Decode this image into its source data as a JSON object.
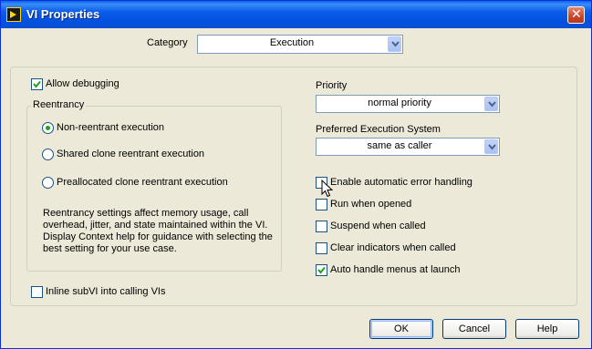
{
  "window": {
    "title": "VI Properties",
    "app_icon": "labview-vi-icon",
    "close_glyph": "✕"
  },
  "category": {
    "label": "Category",
    "value": "Execution"
  },
  "allow_debugging": {
    "label": "Allow debugging",
    "checked": true
  },
  "reentrancy": {
    "legend": "Reentrancy",
    "options": [
      {
        "label": "Non-reentrant execution",
        "selected": true
      },
      {
        "label": "Shared clone reentrant execution",
        "selected": false
      },
      {
        "label": "Preallocated clone reentrant execution",
        "selected": false
      }
    ],
    "note": "Reentrancy settings affect memory usage, call overhead, jitter, and state maintained within the VI. Display Context help for guidance with selecting the best setting for your use case."
  },
  "inline_subvi": {
    "label": "Inline subVI into calling VIs",
    "checked": false
  },
  "priority": {
    "label": "Priority",
    "value": "normal priority"
  },
  "execution_system": {
    "label": "Preferred Execution System",
    "value": "same as caller"
  },
  "options": [
    {
      "label": "Enable automatic error handling",
      "checked": false
    },
    {
      "label": "Run when opened",
      "checked": false
    },
    {
      "label": "Suspend when called",
      "checked": false
    },
    {
      "label": "Clear indicators when called",
      "checked": false
    },
    {
      "label": "Auto handle menus at launch",
      "checked": true
    }
  ],
  "buttons": {
    "ok": "OK",
    "cancel": "Cancel",
    "help": "Help"
  },
  "colors": {
    "titlebar": "#0a5ce8",
    "dialog_bg": "#ece9d8",
    "checkmark": "#21a121",
    "close_button": "#c8452a"
  }
}
